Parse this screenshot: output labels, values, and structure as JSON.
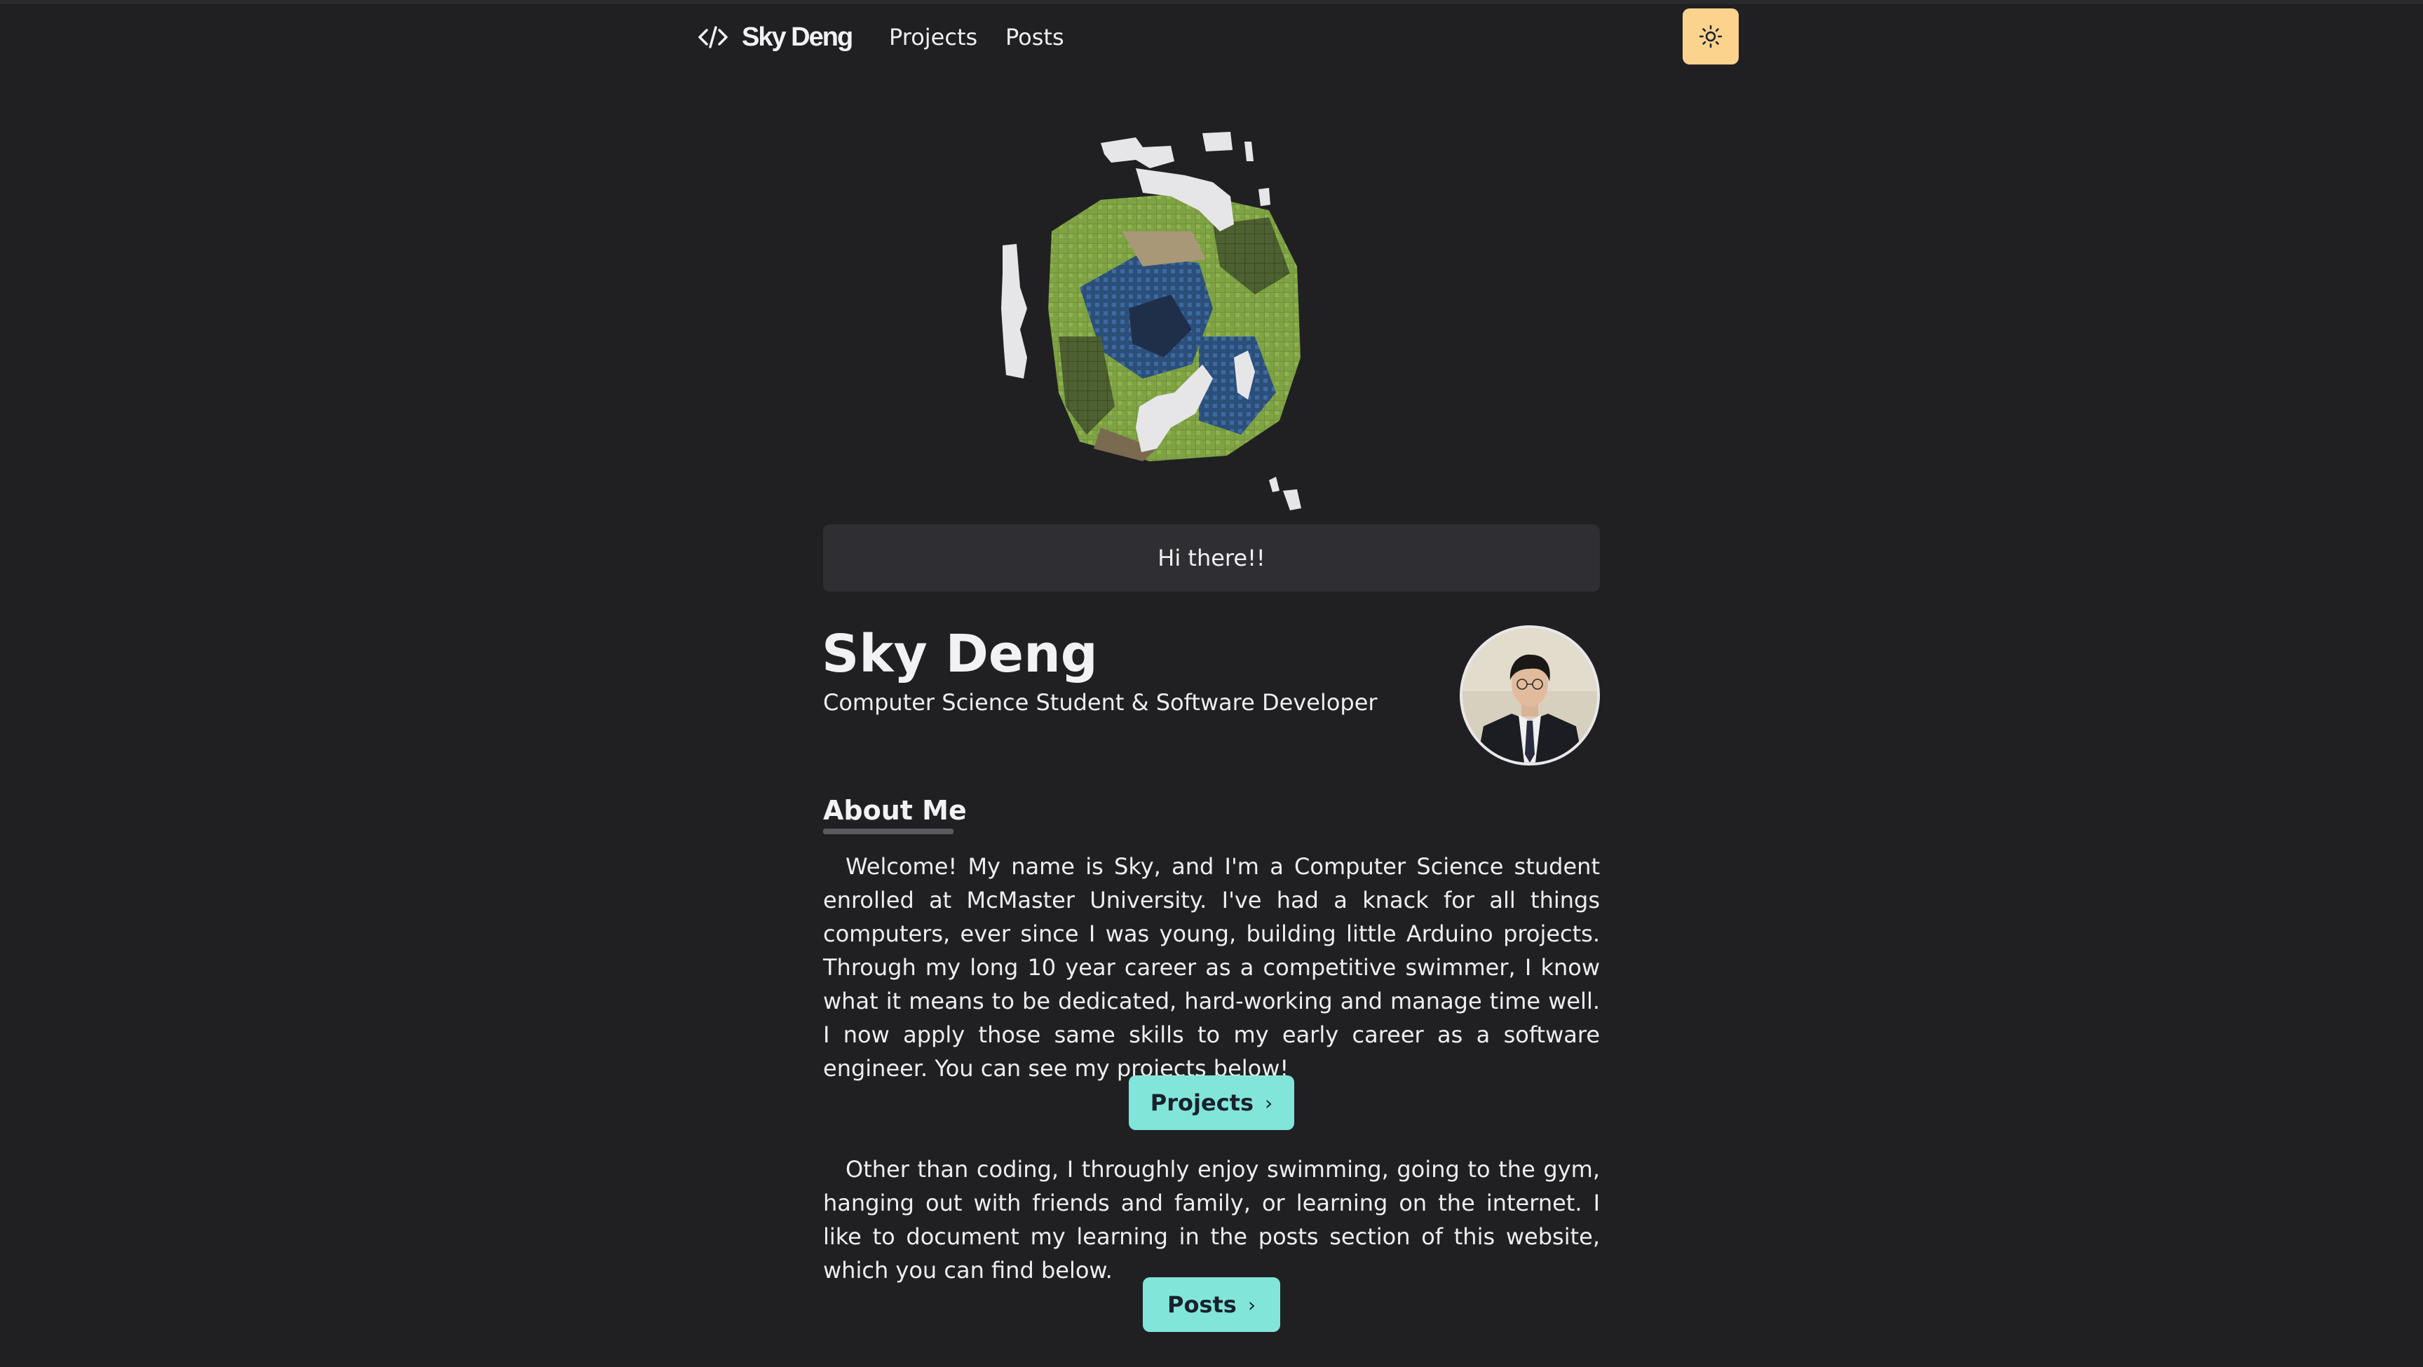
{
  "nav": {
    "brand": "Sky Deng",
    "links": [
      "Projects",
      "Posts"
    ],
    "theme_toggle_icon": "sun-icon"
  },
  "hero": {
    "greeting": "Hi there!!"
  },
  "profile": {
    "name": "Sky Deng",
    "tagline": "Computer Science Student & Software Developer"
  },
  "about": {
    "title": "About Me",
    "paragraph1": "Welcome! My name is Sky, and I'm a Computer Science student enrolled at McMaster University. I've had a knack for all things computers, ever since I was young, building little Arduino projects. Through my long 10 year career as a competitive swimmer, I know what it means to be dedicated, hard-working and manage time well. I now apply those same skills to my early career as a software engineer. You can see my projects below!",
    "projects_button": "Projects",
    "paragraph2": "Other than coding, I throughly enjoy swimming, going to the gym, hanging out with friends and family, or learning on the internet. I like to document my learning in the posts section of this website, which you can find below.",
    "posts_button": "Posts"
  },
  "colors": {
    "background": "#202023",
    "accent": "#81e6d9",
    "theme_button": "#fbd38d",
    "card": "#2f2f33"
  }
}
